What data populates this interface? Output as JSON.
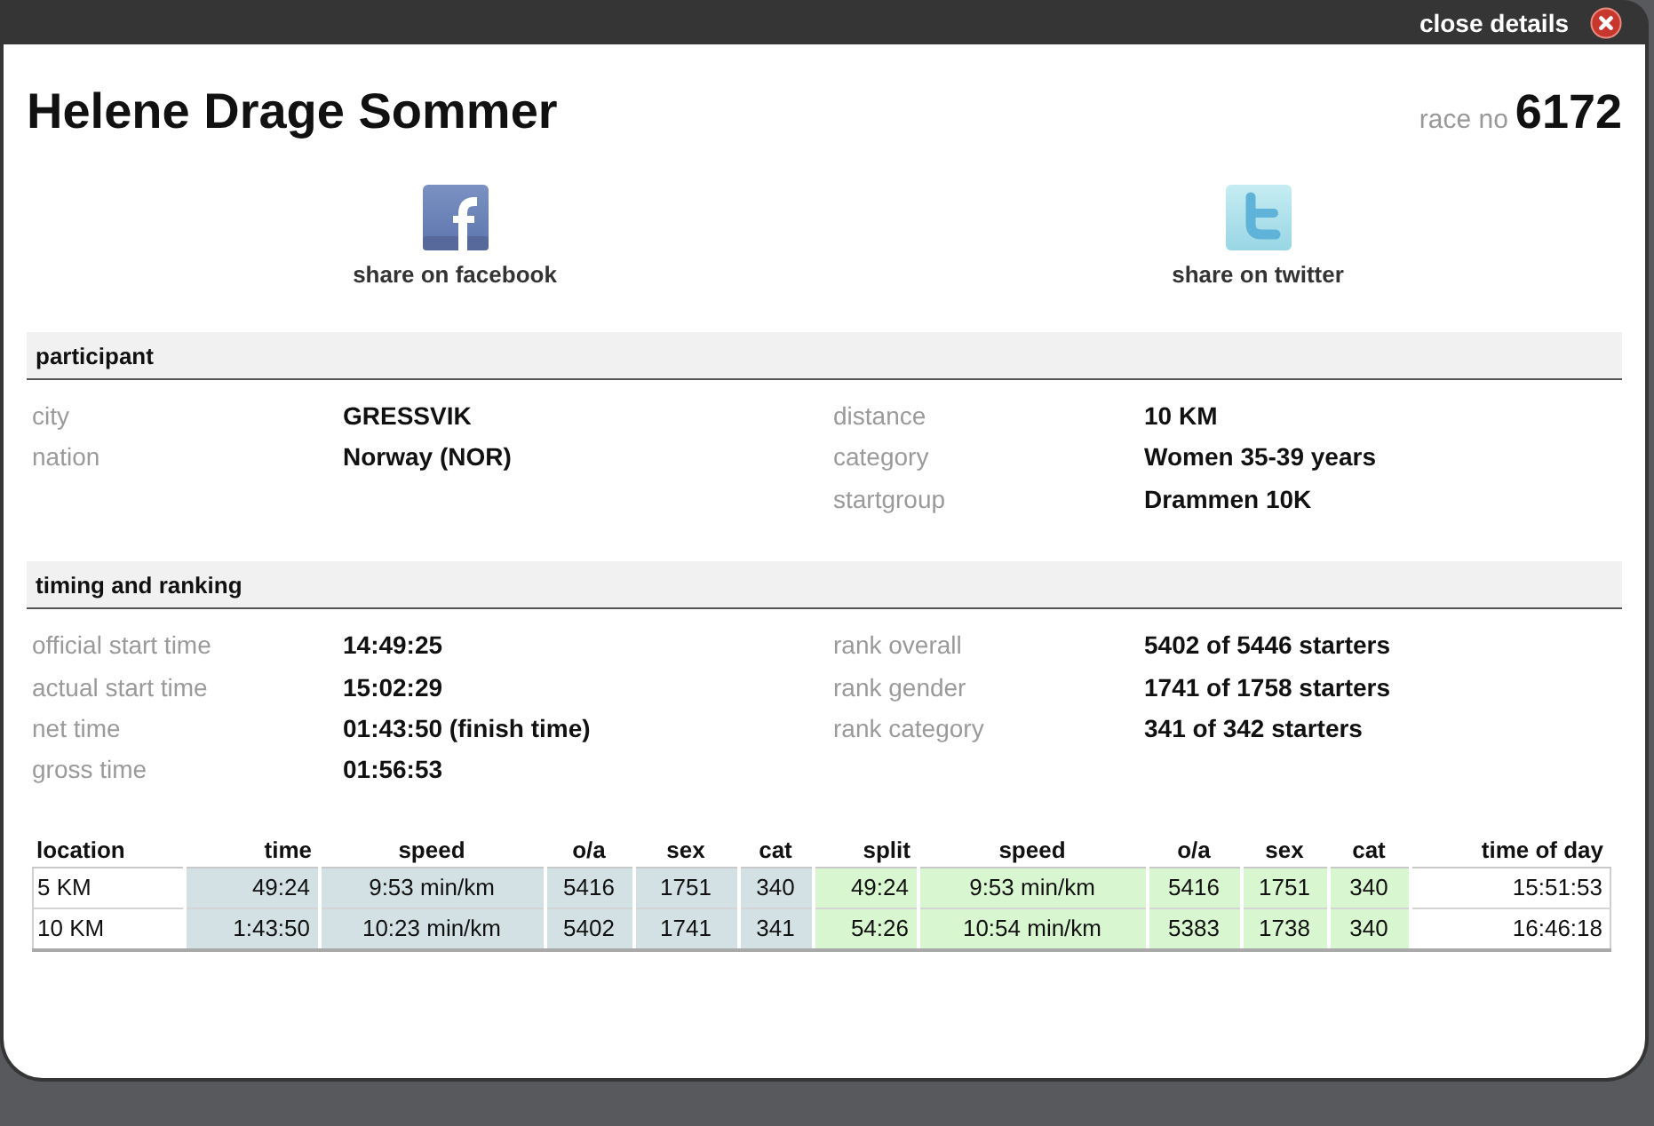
{
  "top_bar": {
    "close_label": "close details"
  },
  "header": {
    "name": "Helene Drage Sommer",
    "race_no_label": "race no",
    "race_no": "6172"
  },
  "share": [
    {
      "kind": "facebook",
      "label": "share on facebook"
    },
    {
      "kind": "twitter",
      "label": "share on twitter"
    }
  ],
  "sections": [
    {
      "title": "participant",
      "left": [
        {
          "label": "city",
          "value": "GRESSVIK"
        },
        {
          "label": "nation",
          "value": "Norway (NOR)"
        }
      ],
      "right": [
        {
          "label": "distance",
          "value": "10 KM"
        },
        {
          "label": "category",
          "value": "Women 35-39 years"
        },
        {
          "label": "startgroup",
          "value": "Drammen 10K"
        }
      ]
    },
    {
      "title": "timing and ranking",
      "left": [
        {
          "label": "official start time",
          "value": "14:49:25"
        },
        {
          "label": "actual start time",
          "value": "15:02:29"
        },
        {
          "label": "net time",
          "value": "01:43:50 (finish time)"
        },
        {
          "label": "gross time",
          "value": "01:56:53"
        }
      ],
      "right": [
        {
          "label": "rank overall",
          "value": "5402 of 5446 starters"
        },
        {
          "label": "rank gender",
          "value": "1741 of 1758 starters"
        },
        {
          "label": "rank category",
          "value": "341 of 342 starters"
        }
      ]
    }
  ],
  "splits": {
    "columns": [
      {
        "label": "location",
        "kind": "text"
      },
      {
        "label": "time",
        "kind": "duration",
        "color": "#d3e0e4"
      },
      {
        "label": "speed",
        "kind": "pace",
        "color": "#d3e0e4"
      },
      {
        "label": "o/a",
        "kind": "rank",
        "color": "#d3e0e4"
      },
      {
        "label": "sex",
        "kind": "rank",
        "color": "#d3e0e4"
      },
      {
        "label": "cat",
        "kind": "rank",
        "color": "#d3e0e4"
      },
      {
        "label": "split",
        "kind": "duration",
        "color": "#d8f6cf"
      },
      {
        "label": "speed",
        "kind": "pace",
        "color": "#d8f6cf"
      },
      {
        "label": "o/a",
        "kind": "rank",
        "color": "#d8f6cf"
      },
      {
        "label": "sex",
        "kind": "rank",
        "color": "#d8f6cf"
      },
      {
        "label": "cat",
        "kind": "rank",
        "color": "#d8f6cf"
      },
      {
        "label": "time of day",
        "kind": "clock"
      }
    ],
    "rows": [
      {
        "cells": [
          "5 KM",
          "49:24",
          "9:53 min/km",
          "5416",
          "1751",
          "340",
          "49:24",
          "9:53 min/km",
          "5416",
          "1751",
          "340",
          "15:51:53"
        ]
      },
      {
        "cells": [
          "10 KM",
          "1:43:50",
          "10:23 min/km",
          "5402",
          "1741",
          "341",
          "54:26",
          "10:54 min/km",
          "5383",
          "1738",
          "340",
          "16:46:18"
        ]
      }
    ]
  }
}
